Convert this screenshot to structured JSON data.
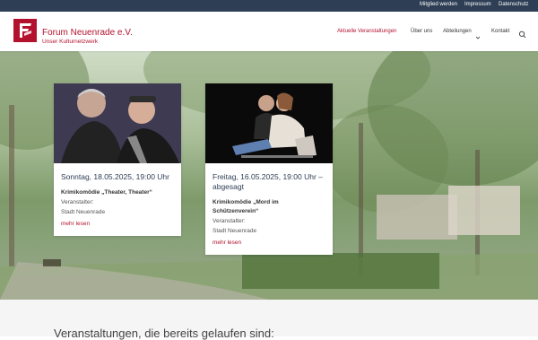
{
  "topbar": {
    "links": [
      "Mitglied werden",
      "Impressum",
      "Datenschutz"
    ]
  },
  "brand": {
    "title": "Forum Neuenrade e.V.",
    "subtitle": "Unser Kulturnetzwerk",
    "color": "#b3122f",
    "logo_icon": "forum-f-logo"
  },
  "nav": {
    "items": [
      "Aktuelle Veranstaltungen",
      "Über uns",
      "Abteilungen",
      "Kontakt"
    ],
    "active": "Aktuelle Veranstaltungen",
    "dropdown_icon": "chevron-down-icon",
    "search_icon": "search-icon"
  },
  "events": [
    {
      "date": "Sonntag, 18.05.2025, 19:00 Uhr",
      "title": "Krimikomödie „Theater, Theater“",
      "organizer_label": "Veranstalter:",
      "organizer": "Stadt Neuenrade",
      "more": "mehr lesen"
    },
    {
      "date": "Freitag, 16.05.2025, 19:00 Uhr – abgesagt",
      "title": "Krimikomödie „Mord im Schützenverein“",
      "organizer_label": "Veranstalter:",
      "organizer": "Stadt Neuenrade",
      "more": "mehr lesen"
    }
  ],
  "past_heading": "Veranstaltungen, die bereits gelaufen sind:",
  "colors": {
    "topbar": "#2e3e55",
    "accent": "#b3122f",
    "date_text": "#2e3e55"
  }
}
